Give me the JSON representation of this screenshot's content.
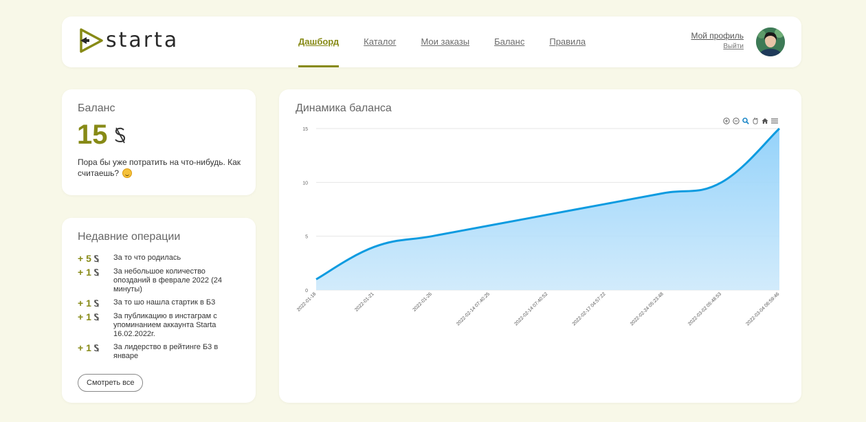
{
  "brand": {
    "name": "starta"
  },
  "nav": [
    {
      "label": "Дашборд",
      "active": true
    },
    {
      "label": "Каталог",
      "active": false
    },
    {
      "label": "Мои заказы",
      "active": false
    },
    {
      "label": "Баланс",
      "active": false
    },
    {
      "label": "Правила",
      "active": false
    }
  ],
  "profile": {
    "link": "Мой профиль",
    "logout": "Выйти"
  },
  "balance": {
    "title": "Баланс",
    "amount": "15",
    "message": "Пора бы уже потратить на что-нибудь. Как считаешь?"
  },
  "operations": {
    "title": "Недавние операции",
    "items": [
      {
        "amount": "+ 5",
        "desc": "За то что родилась"
      },
      {
        "amount": "+ 1",
        "desc": "За небольшое количество опозданий в феврале 2022 (24 минуты)"
      },
      {
        "amount": "+ 1",
        "desc": "За то шо нашла стартик в Б3"
      },
      {
        "amount": "+ 1",
        "desc": "За публикацию в инстаграм с упоминанием аккаунта Starta 16.02.2022г."
      },
      {
        "amount": "+ 1",
        "desc": "За лидерство в рейтинге Б3 в январе"
      }
    ],
    "view_all": "Смотреть все"
  },
  "chart_title": "Динамика баланса",
  "chart_data": {
    "type": "area",
    "x": [
      "2022-01-18",
      "2022-01-21",
      "2022-01-26",
      "2022-02-14 07:40:25",
      "2022-02-14 07:40:52",
      "2022-02-17 04:57:22",
      "2022-02-24 05:23:48",
      "2022-03-02 05:48:53",
      "2022-03-04 06:59:46"
    ],
    "series": [
      {
        "values": [
          1,
          4,
          5,
          6,
          7,
          8,
          9,
          10,
          15
        ]
      }
    ],
    "yticks": [
      "0",
      "5",
      "10",
      "15"
    ],
    "ylim": [
      0,
      15
    ],
    "grid": true,
    "colors": {
      "line": "#0d9be0",
      "fill": "#9fd8fb"
    }
  },
  "colors": {
    "accent": "#878a16",
    "background": "#f8f8e8"
  }
}
